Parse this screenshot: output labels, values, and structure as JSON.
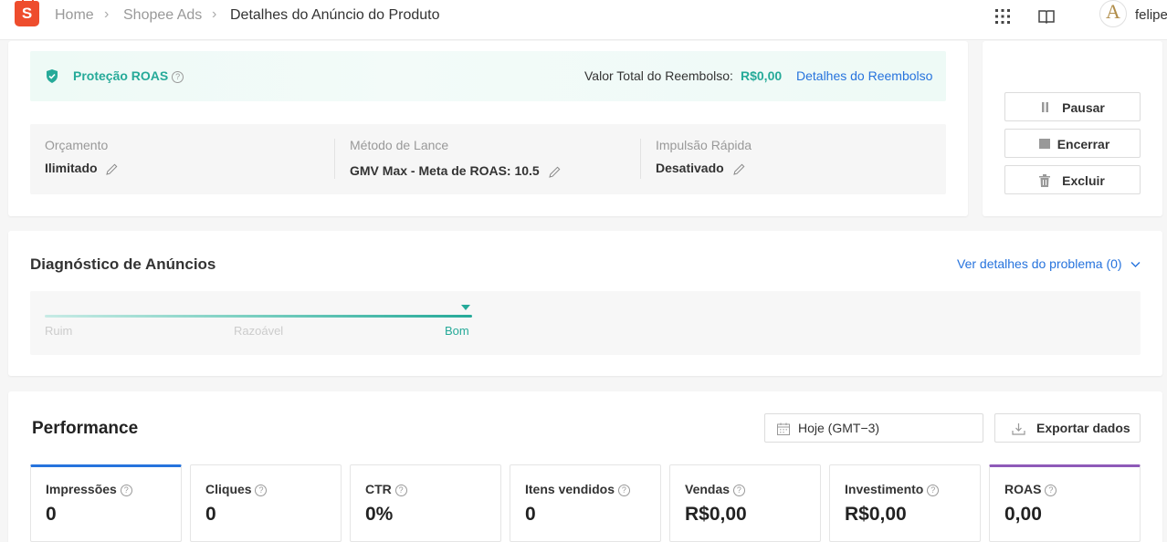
{
  "header": {
    "breadcrumbs": [
      "Home",
      "Shopee Ads",
      "Detalhes do Anúncio do Produto"
    ],
    "logo_letter": "S",
    "avatar_letter": "A",
    "username": "felipe"
  },
  "roas_protection": {
    "label": "Proteção ROAS",
    "help": "?",
    "refund_label": "Valor Total do Reembolso:",
    "refund_value": "R$0,00",
    "refund_link": "Detalhes do Reembolso"
  },
  "settings": [
    {
      "label": "Orçamento",
      "value": "Ilimitado"
    },
    {
      "label": "Método de Lance",
      "value": "GMV Max - Meta de ROAS: 10.5"
    },
    {
      "label": "Impulsão Rápida",
      "value": "Desativado"
    }
  ],
  "actions": {
    "pause": "Pausar",
    "end": "Encerrar",
    "delete": "Excluir"
  },
  "diagnostics": {
    "title": "Diagnóstico de Anúncios",
    "link": "Ver detalhes do problema (0)",
    "levels": [
      "Ruim",
      "Razoável",
      "Bom"
    ],
    "current_level": "Bom"
  },
  "performance": {
    "title": "Performance",
    "date_range": "Hoje (GMT−3)",
    "export_label": "Exportar dados",
    "metrics": [
      {
        "label": "Impressões",
        "value": "0"
      },
      {
        "label": "Cliques",
        "value": "0"
      },
      {
        "label": "CTR",
        "value": "0%"
      },
      {
        "label": "Itens vendidos",
        "value": "0"
      },
      {
        "label": "Vendas",
        "value": "R$0,00"
      },
      {
        "label": "Investimento",
        "value": "R$0,00"
      },
      {
        "label": "ROAS",
        "value": "0,00"
      }
    ]
  },
  "colors": {
    "brand": "#ee4d2d",
    "teal": "#26aa99",
    "link": "#2673dd",
    "metric_blue": "#2673dd",
    "metric_purple": "#8e5ab8"
  }
}
